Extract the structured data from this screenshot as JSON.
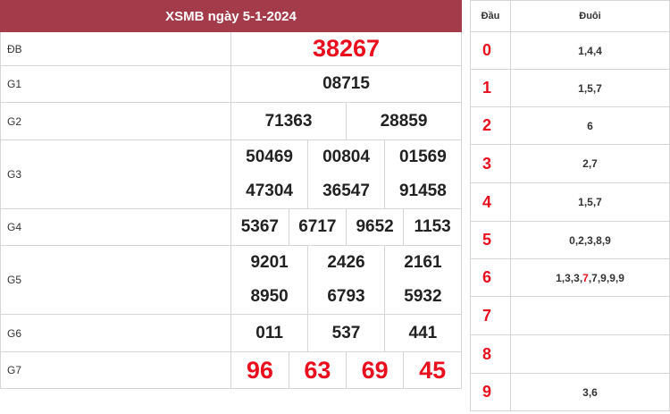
{
  "title": "XSMB ngày 5-1-2024",
  "results": {
    "db": {
      "label": "ĐB",
      "numbers": [
        "38267"
      ]
    },
    "g1": {
      "label": "G1",
      "numbers": [
        "08715"
      ]
    },
    "g2": {
      "label": "G2",
      "numbers": [
        "71363",
        "28859"
      ]
    },
    "g3": {
      "label": "G3",
      "numbers": [
        "50469",
        "00804",
        "01569",
        "47304",
        "36547",
        "91458"
      ]
    },
    "g4": {
      "label": "G4",
      "numbers": [
        "5367",
        "6717",
        "9652",
        "1153"
      ]
    },
    "g5": {
      "label": "G5",
      "numbers": [
        "9201",
        "2426",
        "2161",
        "8950",
        "6793",
        "5932"
      ]
    },
    "g6": {
      "label": "G6",
      "numbers": [
        "011",
        "537",
        "441"
      ]
    },
    "g7": {
      "label": "G7",
      "numbers": [
        "96",
        "63",
        "69",
        "45"
      ]
    }
  },
  "loto": {
    "head_header": "Đầu",
    "tail_header": "Đuôi",
    "rows": [
      {
        "head": "0",
        "tail": "1,4,4"
      },
      {
        "head": "1",
        "tail": "1,5,7"
      },
      {
        "head": "2",
        "tail": "6"
      },
      {
        "head": "3",
        "tail": "2,7"
      },
      {
        "head": "4",
        "tail": "1,5,7"
      },
      {
        "head": "5",
        "tail": "0,2,3,8,9"
      },
      {
        "head": "6",
        "tail_parts": [
          "1,3,3,",
          "7",
          ",7,9,9,9"
        ]
      },
      {
        "head": "7",
        "tail": ""
      },
      {
        "head": "8",
        "tail": ""
      },
      {
        "head": "9",
        "tail": "3,6"
      }
    ]
  },
  "colors": {
    "header_bg": "#a33b4b",
    "highlight": "#e8101e",
    "border": "#d6d6d6"
  }
}
